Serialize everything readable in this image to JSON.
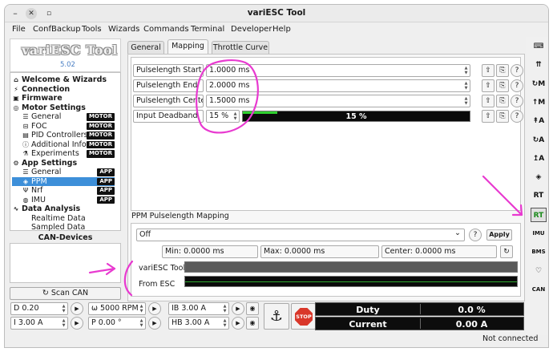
{
  "window": {
    "title": "variESC Tool",
    "close_glyph": "✕",
    "minimize_glyph": "–",
    "maximize_glyph": "▫"
  },
  "menu": [
    "File",
    "ConfBackup",
    "Tools",
    "Wizards",
    "Commands",
    "Terminal",
    "Developer",
    "Help"
  ],
  "logo": {
    "text": "variESC Tool",
    "version": "5.02"
  },
  "tree": [
    {
      "label": "Welcome & Wizards",
      "icon": "house-icon",
      "glyph": "⌂",
      "bold": true
    },
    {
      "label": "Connection",
      "icon": "plug-icon",
      "glyph": "⚡",
      "bold": true
    },
    {
      "label": "Firmware",
      "icon": "chip-icon",
      "glyph": "▣",
      "bold": true
    },
    {
      "label": "Motor Settings",
      "icon": "motor-icon",
      "glyph": "◎",
      "bold": true
    },
    {
      "label": "General",
      "icon": "sliders-icon",
      "glyph": "☰",
      "badge": "MOTOR"
    },
    {
      "label": "FOC",
      "icon": "foc-icon",
      "glyph": "⊟",
      "badge": "MOTOR"
    },
    {
      "label": "PID Controllers",
      "icon": "pid-icon",
      "glyph": "▤",
      "badge": "MOTOR"
    },
    {
      "label": "Additional Info",
      "icon": "info-icon",
      "glyph": "ⓘ",
      "badge": "MOTOR"
    },
    {
      "label": "Experiments",
      "icon": "flask-icon",
      "glyph": "⚗",
      "badge": "MOTOR"
    },
    {
      "label": "App Settings",
      "icon": "app-settings-icon",
      "glyph": "⚙",
      "bold": true
    },
    {
      "label": "General",
      "icon": "sliders-icon",
      "glyph": "☰",
      "badge": "APP"
    },
    {
      "label": "PPM",
      "icon": "gamepad-icon",
      "glyph": "◈",
      "badge": "APP",
      "selected": true
    },
    {
      "label": "Nrf",
      "icon": "radio-icon",
      "glyph": "Ψ",
      "badge": "APP"
    },
    {
      "label": "IMU",
      "icon": "imu-icon",
      "glyph": "◍",
      "badge": "APP"
    },
    {
      "label": "Data Analysis",
      "icon": "chart-icon",
      "glyph": "∿",
      "bold": true
    },
    {
      "label": "Realtime Data",
      "icon": "realtime-icon",
      "glyph": "",
      "badge": ""
    },
    {
      "label": "Sampled Data",
      "icon": "sampled-icon",
      "glyph": "",
      "badge": ""
    }
  ],
  "can": {
    "title": "CAN-Devices",
    "scan_label": "Scan CAN",
    "scan_glyph": "↻"
  },
  "tabs": [
    "General",
    "Mapping",
    "Throttle Curve"
  ],
  "params": [
    {
      "label": "Pulselength Start",
      "value": "1.0000 ms"
    },
    {
      "label": "Pulselength End",
      "value": "2.0000 ms"
    },
    {
      "label": "Pulselength Center",
      "value": "1.5000 ms"
    },
    {
      "label": "Input Deadband",
      "value": "15 %",
      "bar_text": "15 %",
      "bar_level": 0.15
    }
  ],
  "param_button_glyphs": [
    "⇧",
    "⎘",
    "?"
  ],
  "spin_glyphs": [
    "▲",
    "▼"
  ],
  "mapping": {
    "title": "PPM Pulselength Mapping",
    "mode": "Off",
    "dropdown_glyph": "⌄",
    "help_glyph": "?",
    "apply_label": "Apply",
    "reset_glyph": "↻",
    "min": "Min: 0.0000 ms",
    "max": "Max: 0.0000 ms",
    "center": "Center: 0.0000 ms",
    "tool_label": "variESC Tool",
    "esc_label": "From ESC"
  },
  "controls": [
    {
      "value": "D 0.20"
    },
    {
      "value": "ω 5000 RPM"
    },
    {
      "value": "IB 3.00 A"
    },
    {
      "value": "I 3.00 A"
    },
    {
      "value": "P 0.00 °"
    },
    {
      "value": "HB 3.00 A"
    }
  ],
  "control_glyphs": {
    "play": "▶",
    "brake": "◉",
    "anchor": "⚓",
    "stop": "STOP"
  },
  "gauges": [
    {
      "label": "Duty",
      "value": "0.0 %"
    },
    {
      "label": "Current",
      "value": "0.00 A"
    }
  ],
  "sidebar_icons": [
    {
      "name": "keyboard-icon",
      "glyph": "⌨"
    },
    {
      "name": "arrows-up-icon",
      "glyph": "⇈"
    },
    {
      "name": "om-icon",
      "glyph": "↻M"
    },
    {
      "name": "m-icon",
      "glyph": "↑M"
    },
    {
      "name": "ta-icon",
      "glyph": "↟A"
    },
    {
      "name": "rotate-a-icon",
      "glyph": "↻A"
    },
    {
      "name": "ta2-icon",
      "glyph": "↥A"
    },
    {
      "name": "gamepad-icon",
      "glyph": "◈"
    },
    {
      "name": "rt-icon",
      "glyph": "RT"
    },
    {
      "name": "rt-app-icon",
      "glyph": "RT"
    },
    {
      "name": "imu-icon",
      "glyph": "IMU"
    },
    {
      "name": "bms-icon",
      "glyph": "BMS"
    },
    {
      "name": "heart-icon",
      "glyph": "♡"
    },
    {
      "name": "can-icon",
      "glyph": "CAN"
    }
  ],
  "status": "Not connected",
  "accent": {
    "pink": "#e83ad0",
    "selected": "#3d8fd9",
    "bar_green": "#2fd12f",
    "stop_red": "#d9372a"
  }
}
